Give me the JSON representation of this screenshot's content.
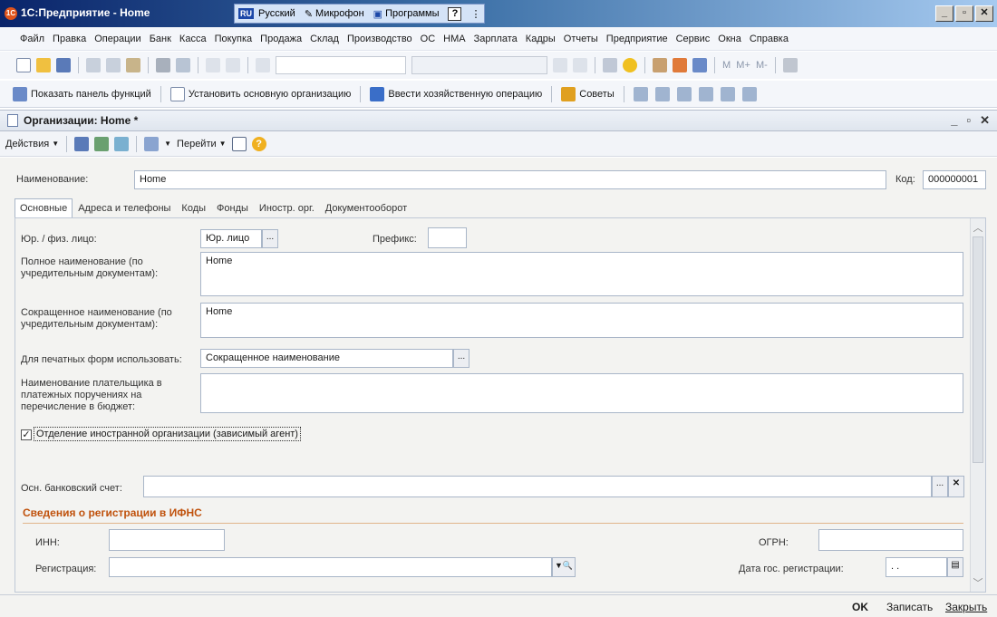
{
  "app": {
    "title": "1С:Предприятие - Home",
    "icon_text": "1С",
    "lang_badge": "RU",
    "lang_label": "Русский",
    "mic_label": "Микрофон",
    "programs_label": "Программы",
    "help_glyph": "?"
  },
  "window_buttons": {
    "min": "_",
    "max": "▫",
    "close": "✕"
  },
  "menu": [
    "Файл",
    "Правка",
    "Операции",
    "Банк",
    "Касса",
    "Покупка",
    "Продажа",
    "Склад",
    "Производство",
    "ОС",
    "НМА",
    "Зарплата",
    "Кадры",
    "Отчеты",
    "Предприятие",
    "Сервис",
    "Окна",
    "Справка"
  ],
  "toolbar2": {
    "show_panel": "Показать панель функций",
    "set_org": "Установить основную организацию",
    "enter_op": "Ввести хозяйственную операцию",
    "tips": "Советы"
  },
  "document": {
    "title": "Организации: Home *",
    "controls": {
      "min": "_",
      "restore": "▫",
      "close": "✕"
    }
  },
  "actions": {
    "actions_label": "Действия",
    "goto_label": "Перейти",
    "help_glyph": "?"
  },
  "form": {
    "name_label": "Наименование:",
    "name_value": "Home",
    "code_label": "Код:",
    "code_value": "000000001",
    "tabs": [
      "Основные",
      "Адреса и телефоны",
      "Коды",
      "Фонды",
      "Иностр. орг.",
      "Документооборот"
    ],
    "entity_label": "Юр. / физ. лицо:",
    "entity_value": "Юр. лицо",
    "prefix_label": "Префикс:",
    "prefix_value": "",
    "full_name_label": "Полное наименование (по учредительным документам):",
    "full_name_value": "Home",
    "short_name_label": "Сокращенное наименование (по учредительным документам):",
    "short_name_value": "Home",
    "print_label": "Для печатных форм использовать:",
    "print_value": "Сокращенное наименование",
    "payer_label": "Наименование плательщика в платежных поручениях на перечисление в бюджет:",
    "payer_value": "",
    "foreign_checkbox_label": "Отделение иностранной организации (зависимый агент)",
    "foreign_checked": true,
    "bank_label": "Осн. банковский счет:",
    "bank_value": "",
    "section_title": "Сведения о регистрации в ИФНС",
    "inn_label": "ИНН:",
    "inn_value": "",
    "ogrn_label": "ОГРН:",
    "ogrn_value": "",
    "reg_label": "Регистрация:",
    "reg_value": "",
    "reg_date_label": "Дата гос. регистрации:",
    "reg_date_value": ". ."
  },
  "footer": {
    "ok": "OK",
    "save": "Записать",
    "close": "Закрыть"
  }
}
